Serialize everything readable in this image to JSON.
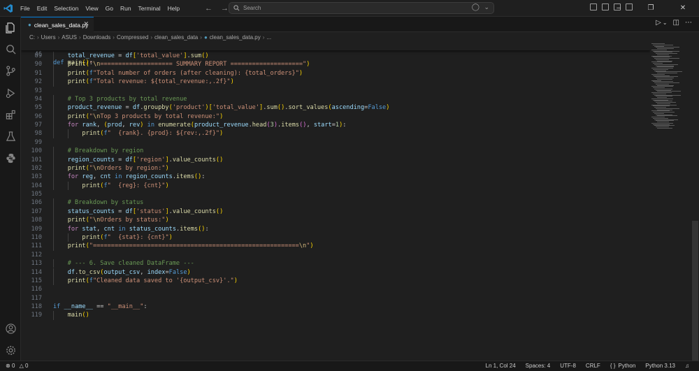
{
  "titlebar": {
    "menu": [
      "File",
      "Edit",
      "Selection",
      "View",
      "Go",
      "Run",
      "Terminal",
      "Help"
    ],
    "search_placeholder": "Search"
  },
  "tabs": [
    {
      "label": "clean_sales_data.py",
      "active": true
    }
  ],
  "breadcrumb": [
    "C:",
    "Users",
    "ASUS",
    "Downloads",
    "Compressed",
    "clean_sales_data",
    "clean_sales_data.py",
    "..."
  ],
  "sticky": {
    "line": "46",
    "text": "def main():"
  },
  "code_lines": [
    {
      "n": "89",
      "t": "    total_revenue = df['total_value'].sum()"
    },
    {
      "n": "90",
      "t": "    print(\"\\n==================== SUMMARY REPORT ====================\")"
    },
    {
      "n": "91",
      "t": "    print(f\"Total number of orders (after cleaning): {total_orders}\")"
    },
    {
      "n": "92",
      "t": "    print(f\"Total revenue: ${total_revenue:,.2f}\")"
    },
    {
      "n": "93",
      "t": ""
    },
    {
      "n": "94",
      "t": "    # Top 3 products by total revenue"
    },
    {
      "n": "95",
      "t": "    product_revenue = df.groupby('product')['total_value'].sum().sort_values(ascending=False)"
    },
    {
      "n": "96",
      "t": "    print(\"\\nTop 3 products by total revenue:\")"
    },
    {
      "n": "97",
      "t": "    for rank, (prod, rev) in enumerate(product_revenue.head(3).items(), start=1):"
    },
    {
      "n": "98",
      "t": "        print(f\"  {rank}. {prod}: ${rev:,.2f}\")"
    },
    {
      "n": "99",
      "t": ""
    },
    {
      "n": "100",
      "t": "    # Breakdown by region"
    },
    {
      "n": "101",
      "t": "    region_counts = df['region'].value_counts()"
    },
    {
      "n": "102",
      "t": "    print(\"\\nOrders by region:\")"
    },
    {
      "n": "103",
      "t": "    for reg, cnt in region_counts.items():"
    },
    {
      "n": "104",
      "t": "        print(f\"  {reg}: {cnt}\")"
    },
    {
      "n": "105",
      "t": ""
    },
    {
      "n": "106",
      "t": "    # Breakdown by status"
    },
    {
      "n": "107",
      "t": "    status_counts = df['status'].value_counts()"
    },
    {
      "n": "108",
      "t": "    print(\"\\nOrders by status:\")"
    },
    {
      "n": "109",
      "t": "    for stat, cnt in status_counts.items():"
    },
    {
      "n": "110",
      "t": "        print(f\"  {stat}: {cnt}\")"
    },
    {
      "n": "111",
      "t": "    print(\"=========================================================\\n\")"
    },
    {
      "n": "112",
      "t": ""
    },
    {
      "n": "113",
      "t": "    # --- 6. Save cleaned DataFrame ---"
    },
    {
      "n": "114",
      "t": "    df.to_csv(output_csv, index=False)"
    },
    {
      "n": "115",
      "t": "    print(f\"Cleaned data saved to '{output_csv}'.\")"
    },
    {
      "n": "116",
      "t": ""
    },
    {
      "n": "117",
      "t": ""
    },
    {
      "n": "118",
      "t": "if __name__ == \"__main__\":"
    },
    {
      "n": "119",
      "t": "    main()"
    }
  ],
  "statusbar": {
    "errors": "0",
    "warnings": "0",
    "position": "Ln 1, Col 24",
    "spaces": "Spaces: 4",
    "encoding": "UTF-8",
    "eol": "CRLF",
    "language": "Python",
    "interpreter": "Python 3.13"
  },
  "colors": {
    "accent": "#0078d4",
    "keyword": "#569cd6",
    "control": "#c586c0",
    "function": "#dcdcaa",
    "string": "#ce9178",
    "comment": "#6a9955"
  }
}
